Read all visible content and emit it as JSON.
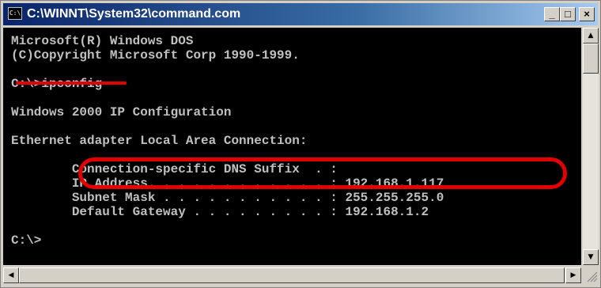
{
  "window": {
    "title": "C:\\WINNT\\System32\\command.com",
    "system_icon_label": "C:\\",
    "minimize_glyph": "_",
    "maximize_glyph": "□",
    "close_glyph": "×"
  },
  "console": {
    "lines": [
      "Microsoft(R) Windows DOS",
      "(C)Copyright Microsoft Corp 1990-1999.",
      "",
      "C:\\>ipconfig",
      "",
      "Windows 2000 IP Configuration",
      "",
      "Ethernet adapter Local Area Connection:",
      "",
      "        Connection-specific DNS Suffix  . :",
      "        IP Address. . . . . . . . . . . . : 192.168.1.117",
      "        Subnet Mask . . . . . . . . . . . : 255.255.255.0",
      "        Default Gateway . . . . . . . . . : 192.168.1.2",
      "",
      "C:\\>"
    ]
  },
  "annotations": {
    "underline_color": "#e00000",
    "highlight_color": "#e00000"
  },
  "scrollbars": {
    "up_arrow_glyph": "▲",
    "down_arrow_glyph": "▼",
    "left_arrow_glyph": "◀",
    "right_arrow_glyph": "▶"
  }
}
